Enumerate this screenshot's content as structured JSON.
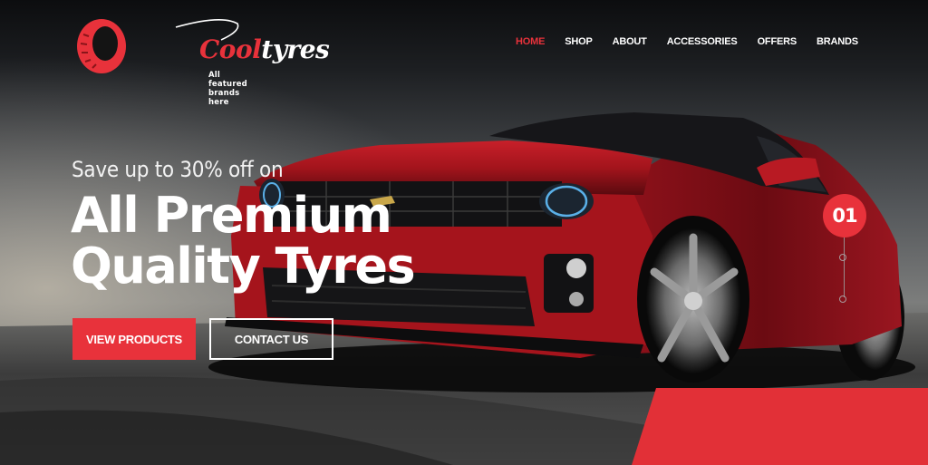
{
  "brand": {
    "name_part1": "Cool",
    "name_part2": "tyres",
    "tagline": "All featured brands here",
    "accent_color": "#e8323b"
  },
  "nav": {
    "items": [
      {
        "label": "HOME",
        "active": true
      },
      {
        "label": "SHOP",
        "active": false
      },
      {
        "label": "ABOUT",
        "active": false
      },
      {
        "label": "ACCESSORIES",
        "active": false
      },
      {
        "label": "OFFERS",
        "active": false
      },
      {
        "label": "BRANDS",
        "active": false
      }
    ]
  },
  "hero": {
    "kicker": "Save up to 30% off on",
    "title_line1": "All Premium",
    "title_line2": "Quality Tyres",
    "primary_button": "VIEW PRODUCTS",
    "secondary_button": "CONTACT US",
    "background_image": "red-sports-car-on-track"
  },
  "slider": {
    "current_slide": "01",
    "total_indicators": 3
  }
}
